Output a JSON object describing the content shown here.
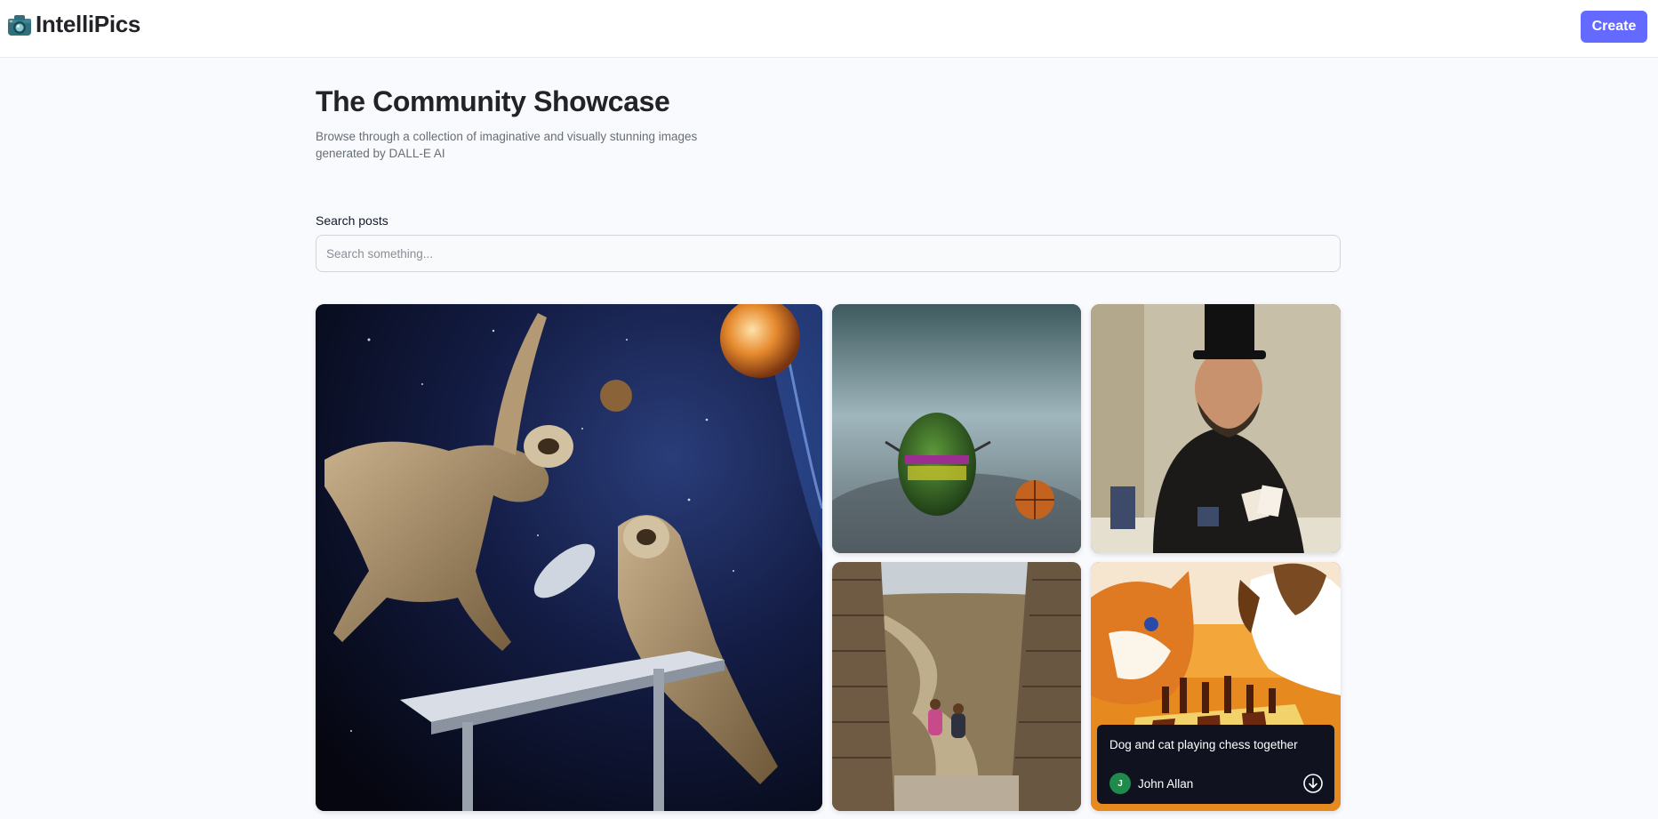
{
  "header": {
    "logo_text": "IntelliPics",
    "create_label": "Create"
  },
  "showcase": {
    "title": "The Community Showcase",
    "subtitle": "Browse through a collection of imaginative and visually stunning images generated by DALL-E AI"
  },
  "search": {
    "label": "Search posts",
    "placeholder": "Search something...",
    "value": ""
  },
  "posts": [
    {
      "subject": "sloths in space"
    },
    {
      "subject": "avocado with basketball in rain"
    },
    {
      "subject": "man in top hat playing cards"
    },
    {
      "subject": "children walking on great wall"
    },
    {
      "subject": "dog and cat playing chess",
      "prompt": "Dog and cat playing chess together",
      "author": "John Allan",
      "author_initial": "J"
    }
  ],
  "colors": {
    "accent": "#6469ff",
    "avatar": "#1f8a4c",
    "overlay": "#10131f"
  }
}
